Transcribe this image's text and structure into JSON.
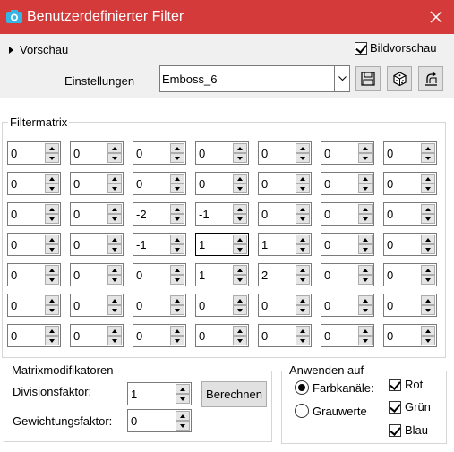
{
  "window": {
    "title": "Benutzerdefinierter Filter"
  },
  "preview": {
    "label": "Vorschau",
    "bildvorschau_label": "Bildvorschau",
    "bildvorschau_checked": true
  },
  "settings": {
    "label": "Einstellungen",
    "value": "Emboss_6"
  },
  "toolbar": {
    "save_icon": "save-icon",
    "random_icon": "dice-icon",
    "reset_icon": "reset-icon"
  },
  "filtermatrix": {
    "title": "Filtermatrix",
    "rows": [
      [
        "0",
        "0",
        "0",
        "0",
        "0",
        "0",
        "0"
      ],
      [
        "0",
        "0",
        "0",
        "0",
        "0",
        "0",
        "0"
      ],
      [
        "0",
        "0",
        "-2",
        "-1",
        "0",
        "0",
        "0"
      ],
      [
        "0",
        "0",
        "-1",
        "1",
        "1",
        "0",
        "0"
      ],
      [
        "0",
        "0",
        "0",
        "1",
        "2",
        "0",
        "0"
      ],
      [
        "0",
        "0",
        "0",
        "0",
        "0",
        "0",
        "0"
      ],
      [
        "0",
        "0",
        "0",
        "0",
        "0",
        "0",
        "0"
      ]
    ],
    "focused_cell": [
      3,
      3
    ]
  },
  "modifiers": {
    "title": "Matrixmodifikatoren",
    "division_label": "Divisionsfaktor:",
    "division_value": "1",
    "weight_label": "Gewichtungsfaktor:",
    "weight_value": "0",
    "calc_button": "Berechnen"
  },
  "apply": {
    "title": "Anwenden auf",
    "color_channels_label": "Farbkanäle:",
    "grayscale_label": "Grauwerte",
    "selected": "color_channels",
    "red_label": "Rot",
    "green_label": "Grün",
    "blue_label": "Blau",
    "red_checked": true,
    "green_checked": true,
    "blue_checked": true
  },
  "colors": {
    "titlebar": "#d53a3a",
    "window_bg": "#f0f0f0",
    "panel_bg": "#ffffff"
  }
}
